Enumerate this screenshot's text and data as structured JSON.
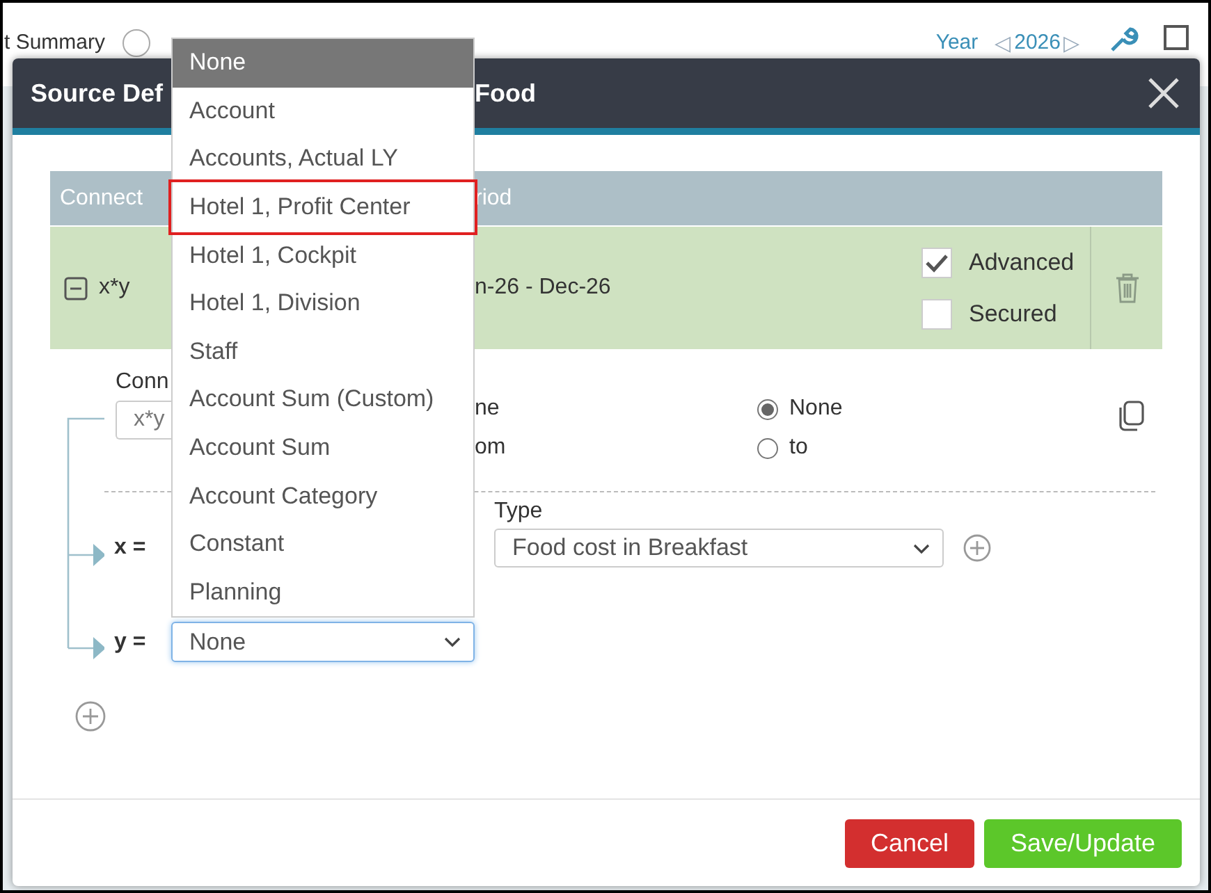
{
  "background": {
    "title_fragment": "t Summary",
    "radio_selected": false,
    "year_label": "Year",
    "year_prev": "◁",
    "year": "2026",
    "year_next": "▷"
  },
  "dialog": {
    "title_start": "Source Def",
    "title_end": "Food"
  },
  "table": {
    "columns": [
      "Connect",
      "riod"
    ],
    "rows": [
      {
        "expanded": true,
        "formula": "x*y",
        "period": "n-26 - Dec-26",
        "options": [
          {
            "label": "Advanced",
            "checked": true
          },
          {
            "label": "Secured",
            "checked": false
          }
        ]
      }
    ]
  },
  "detail": {
    "connect_label": "Conn",
    "connect_value": "x*y",
    "radios_left": [
      {
        "label": "ne"
      },
      {
        "label": "om"
      }
    ],
    "radios_right": [
      {
        "label": "None",
        "selected": true
      },
      {
        "label": "to",
        "selected": false
      }
    ],
    "variables": [
      {
        "name": "x =",
        "type_label": "Type",
        "type_value": "Food cost in Breakfast"
      },
      {
        "name": "y =",
        "value": "None",
        "focused": true
      }
    ]
  },
  "buttons": [
    {
      "label": "Cancel",
      "kind": "cancel"
    },
    {
      "label": "Save/Update",
      "kind": "save"
    }
  ],
  "dropdown": {
    "items": [
      {
        "label": "None",
        "selected": true,
        "outlined": false
      },
      {
        "label": "Account",
        "selected": false,
        "outlined": false
      },
      {
        "label": "Accounts, Actual LY",
        "selected": false,
        "outlined": false
      },
      {
        "label": "Hotel 1, Profit Center",
        "selected": false,
        "outlined": true
      },
      {
        "label": "Hotel 1, Cockpit",
        "selected": false,
        "outlined": false
      },
      {
        "label": "Hotel 1, Division",
        "selected": false,
        "outlined": false
      },
      {
        "label": "Staff",
        "selected": false,
        "outlined": false
      },
      {
        "label": "Account Sum (Custom)",
        "selected": false,
        "outlined": false
      },
      {
        "label": "Account Sum",
        "selected": false,
        "outlined": false
      },
      {
        "label": "Account Category",
        "selected": false,
        "outlined": false
      },
      {
        "label": "Constant",
        "selected": false,
        "outlined": false
      },
      {
        "label": "Planning",
        "selected": false,
        "outlined": false
      }
    ]
  }
}
